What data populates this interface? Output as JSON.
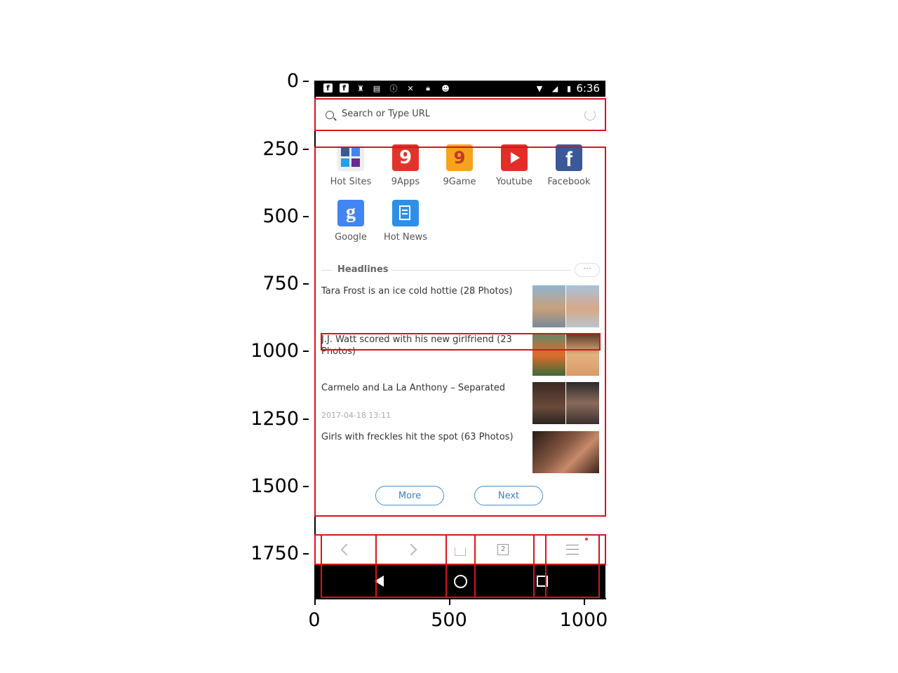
{
  "axes": {
    "y_ticks": [
      "0",
      "250",
      "500",
      "750",
      "1000",
      "1250",
      "1500",
      "1750"
    ],
    "x_ticks": [
      "0",
      "500",
      "1000"
    ]
  },
  "status_bar": {
    "time": "6:36"
  },
  "search": {
    "placeholder": "Search or Type URL"
  },
  "sites": [
    {
      "label": "Hot Sites"
    },
    {
      "label": "9Apps"
    },
    {
      "label": "9Game"
    },
    {
      "label": "Youtube"
    },
    {
      "label": "Facebook"
    },
    {
      "label": "Google"
    },
    {
      "label": "Hot News"
    }
  ],
  "headlines": {
    "title": "Headlines",
    "more_icon": "···",
    "items": [
      {
        "title": "Tara Frost is an ice cold hottie (28 Photos)",
        "date": ""
      },
      {
        "title": "J.J. Watt scored with his new girlfriend (23 Photos)",
        "date": ""
      },
      {
        "title": "Carmelo and La La Anthony – Separated",
        "date": "2017-04-18 13:11"
      },
      {
        "title": "Girls with freckles hit the spot (63 Photos)",
        "date": ""
      }
    ],
    "more_button": "More",
    "next_button": "Next"
  },
  "toolbar": {
    "tab_count": "2"
  },
  "colors": {
    "annotation": "#d6141c",
    "accent": "#3c7fc0"
  }
}
